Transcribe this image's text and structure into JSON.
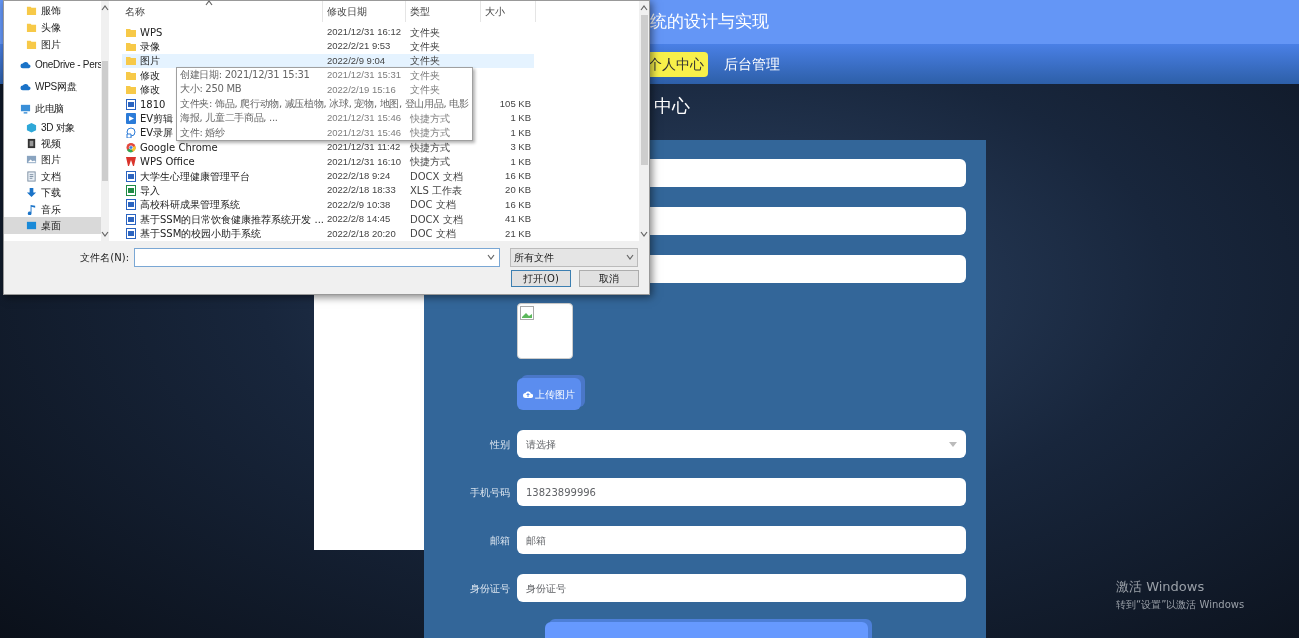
{
  "page": {
    "title": "统的设计与实现",
    "nav": [
      {
        "label": "个人中心",
        "selected": true
      },
      {
        "label": "后台管理",
        "selected": false
      }
    ],
    "heading": "中心",
    "form": {
      "covered_fields": [
        {
          "kind": "text"
        },
        {
          "kind": "text"
        },
        {
          "kind": "text"
        }
      ],
      "upload_button": "上传图片",
      "fields": [
        {
          "kind": "select",
          "label": "性别",
          "placeholder": "请选择"
        },
        {
          "kind": "text",
          "label": "手机号码",
          "value": "13823899996"
        },
        {
          "kind": "text",
          "label": "邮箱",
          "placeholder": "邮箱"
        },
        {
          "kind": "text",
          "label": "身份证号",
          "placeholder": "身份证号"
        }
      ]
    }
  },
  "dialog": {
    "nav": [
      {
        "kind": "folder",
        "label": "服饰",
        "selected": false
      },
      {
        "kind": "folder",
        "label": "头像",
        "selected": false
      },
      {
        "kind": "folder",
        "label": "图片",
        "selected": false
      },
      {
        "kind": "cloud",
        "label": "OneDrive - Pers",
        "selected": false
      },
      {
        "kind": "cloud",
        "label": "WPS网盘",
        "selected": false
      },
      {
        "kind": "pc",
        "label": "此电脑",
        "selected": false
      },
      {
        "kind": "cube",
        "label": "3D 对象",
        "selected": false
      },
      {
        "kind": "video",
        "label": "视频",
        "selected": false
      },
      {
        "kind": "image",
        "label": "图片",
        "selected": false
      },
      {
        "kind": "doc",
        "label": "文档",
        "selected": false
      },
      {
        "kind": "download",
        "label": "下载",
        "selected": false
      },
      {
        "kind": "music",
        "label": "音乐",
        "selected": false
      },
      {
        "kind": "desktop",
        "label": "桌面",
        "selected": true
      }
    ],
    "columns": [
      "名称",
      "修改日期",
      "类型",
      "大小"
    ],
    "rows": [
      {
        "kind": "folder",
        "name": "WPS",
        "date": "2021/12/31 16:12",
        "type": "文件夹",
        "selected": false
      },
      {
        "kind": "folder",
        "name": "录像",
        "date": "2022/2/21 9:53",
        "type": "文件夹",
        "selected": false
      },
      {
        "kind": "folder",
        "name": "图片",
        "date": "2022/2/9 9:04",
        "type": "文件夹",
        "selected": true
      },
      {
        "kind": "folder",
        "name": "修改",
        "date": "2021/12/31 15:31",
        "type": "文件夹",
        "selected": false
      },
      {
        "kind": "folder",
        "name": "修改",
        "date": "2022/2/19 15:16",
        "type": "文件夹",
        "selected": false
      },
      {
        "kind": "doc",
        "name": "1810",
        "size": "105 KB",
        "selected": false
      },
      {
        "kind": "app",
        "name": "EV剪辑",
        "date": "2021/12/31 15:46",
        "type": "快捷方式",
        "size": "1 KB",
        "selected": false
      },
      {
        "kind": "shortcut",
        "name": "EV录屏",
        "date": "2021/12/31 15:46",
        "type": "快捷方式",
        "size": "1 KB",
        "selected": false
      },
      {
        "kind": "chrome",
        "name": "Google Chrome",
        "date": "2021/12/31 11:42",
        "type": "快捷方式",
        "size": "3 KB",
        "selected": false
      },
      {
        "kind": "wps",
        "name": "WPS Office",
        "date": "2021/12/31 16:10",
        "type": "快捷方式",
        "size": "1 KB",
        "selected": false
      },
      {
        "kind": "doc",
        "name": "大学生心理健康管理平台",
        "date": "2022/2/18 9:24",
        "type": "DOCX 文档",
        "size": "16 KB",
        "selected": false
      },
      {
        "kind": "xls",
        "name": "导入",
        "date": "2022/2/18 18:33",
        "type": "XLS 工作表",
        "size": "20 KB",
        "selected": false
      },
      {
        "kind": "doc",
        "name": "高校科研成果管理系统",
        "date": "2022/2/9 10:38",
        "type": "DOC 文档",
        "size": "16 KB",
        "selected": false
      },
      {
        "kind": "doc",
        "name": "基于SSM的日常饮食健康推荐系统开发 ...",
        "date": "2022/2/8 14:45",
        "type": "DOCX 文档",
        "size": "41 KB",
        "selected": false
      },
      {
        "kind": "doc",
        "name": "基于SSM的校园小助手系统",
        "date": "2022/2/18 20:20",
        "type": "DOC 文档",
        "size": "21 KB",
        "selected": false
      }
    ],
    "tooltip": [
      "创建日期: 2021/12/31 15:31",
      "大小: 250 MB",
      "文件夹: 饰品, 爬行动物, 减压植物, 冰球, 宠物, 地图, 登山用品, 电影",
      "海报, 儿童二手商品, ...",
      "文件: 婚纱"
    ],
    "filename_label": "文件名(N):",
    "filter": "所有文件",
    "buttons": [
      "打开(O)",
      "取消"
    ]
  },
  "watermark": [
    "激活 Windows",
    "转到“设置”以激活 Windows"
  ]
}
